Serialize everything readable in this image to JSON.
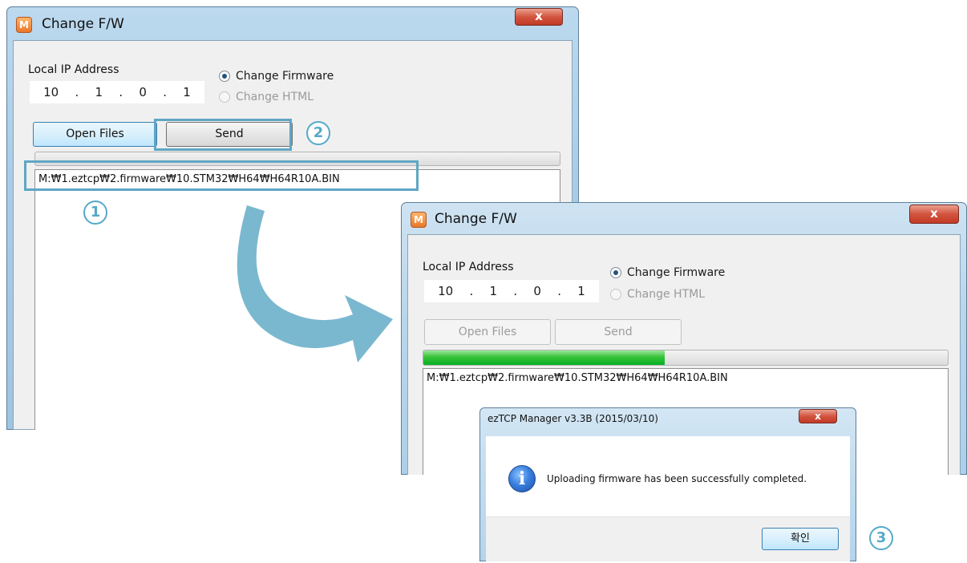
{
  "win1": {
    "title": "Change F/W",
    "app_icon": "M",
    "close_glyph": "x",
    "ip_label": "Local IP Address",
    "ip_octets": [
      "10",
      ".",
      "1",
      ".",
      "0",
      ".",
      "1"
    ],
    "radio_firmware": "Change Firmware",
    "radio_html": "Change HTML",
    "open_files": "Open Files",
    "send": "Send",
    "file_path": "M:₩1.eztcp₩2.firmware₩10.STM32₩H64₩H64R10A.BIN",
    "progress_percent": 0
  },
  "win2": {
    "title": "Change F/W",
    "app_icon": "M",
    "close_glyph": "x",
    "ip_label": "Local IP Address",
    "ip_octets": [
      "10",
      ".",
      "1",
      ".",
      "0",
      ".",
      "1"
    ],
    "radio_firmware": "Change Firmware",
    "radio_html": "Change HTML",
    "open_files": "Open Files",
    "send": "Send",
    "file_path": "M:₩1.eztcp₩2.firmware₩10.STM32₩H64₩H64R10A.BIN",
    "progress_percent": 46
  },
  "dialog": {
    "title": "ezTCP Manager v3.3B (2015/03/10)",
    "close_glyph": "x",
    "icon_glyph": "i",
    "message": "Uploading firmware has been successfully completed.",
    "ok_button": "확인"
  },
  "steps": {
    "one": "1",
    "two": "2",
    "three": "3"
  },
  "colors": {
    "highlight": "#5fa6c4",
    "arrow": "#7ab8cf",
    "progress_green": "#06b025"
  }
}
